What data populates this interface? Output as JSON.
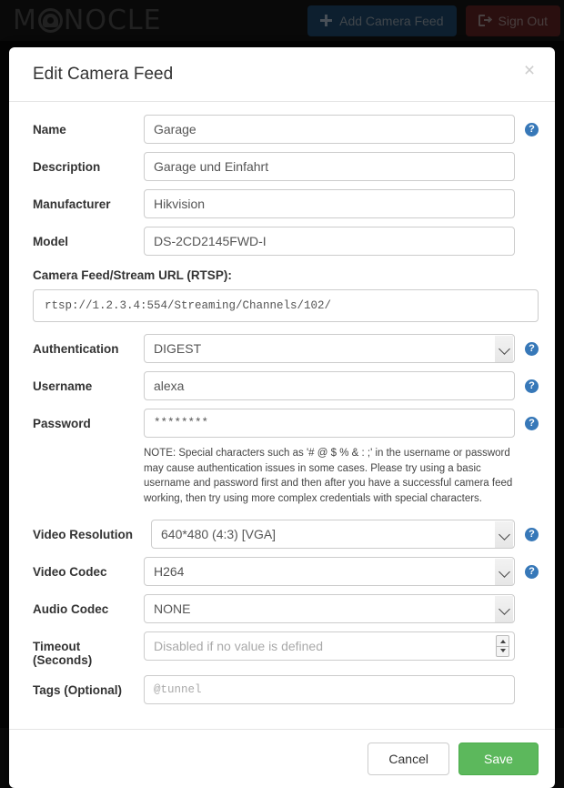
{
  "navbar": {
    "brand": "MONOCLE",
    "brand_parts": {
      "pre": "M",
      "post": "NOCLE"
    },
    "add_button": {
      "label": "Add Camera Feed",
      "icon": "plus-icon",
      "bg": "#1d4568"
    },
    "signout_button": {
      "label": "Sign Out",
      "icon": "sign-out-icon",
      "bg": "#5e2222"
    }
  },
  "modal": {
    "title": "Edit Camera Feed",
    "close_label": "×",
    "fields": {
      "name": {
        "label": "Name",
        "value": "Garage",
        "help": "?"
      },
      "description": {
        "label": "Description",
        "value": "Garage und Einfahrt"
      },
      "manufacturer": {
        "label": "Manufacturer",
        "value": "Hikvision"
      },
      "model": {
        "label": "Model",
        "value": "DS-2CD2145FWD-I"
      },
      "stream_url": {
        "label": "Camera Feed/Stream URL (RTSP):",
        "value": "rtsp://1.2.3.4:554/Streaming/Channels/102/"
      },
      "authentication": {
        "label": "Authentication",
        "value": "DIGEST",
        "help": "?"
      },
      "username": {
        "label": "Username",
        "value": "alexa",
        "help": "?"
      },
      "password": {
        "label": "Password",
        "value": "********",
        "help": "?"
      },
      "video_resolution": {
        "label": "Video Resolution",
        "value": "640*480 (4:3) [VGA]",
        "help": "?"
      },
      "video_codec": {
        "label": "Video Codec",
        "value": "H264",
        "help": "?"
      },
      "audio_codec": {
        "label": "Audio Codec",
        "value": "NONE"
      },
      "timeout": {
        "label": "Timeout (Seconds)",
        "label_line1": "Timeout",
        "label_line2": "(Seconds)",
        "placeholder": "Disabled if no value is defined"
      },
      "tags": {
        "label": "Tags (Optional)",
        "placeholder": "@tunnel"
      }
    },
    "note": "NOTE: Special characters such as '# @ $ % & : ;' in the username or password may cause authentication issues in some cases. Please try using a basic username and password first and then after you have a successful camera feed working, then try using more complex credentials with special characters.",
    "footer": {
      "cancel_label": "Cancel",
      "save_label": "Save",
      "save_color": "#5cb85c"
    }
  }
}
